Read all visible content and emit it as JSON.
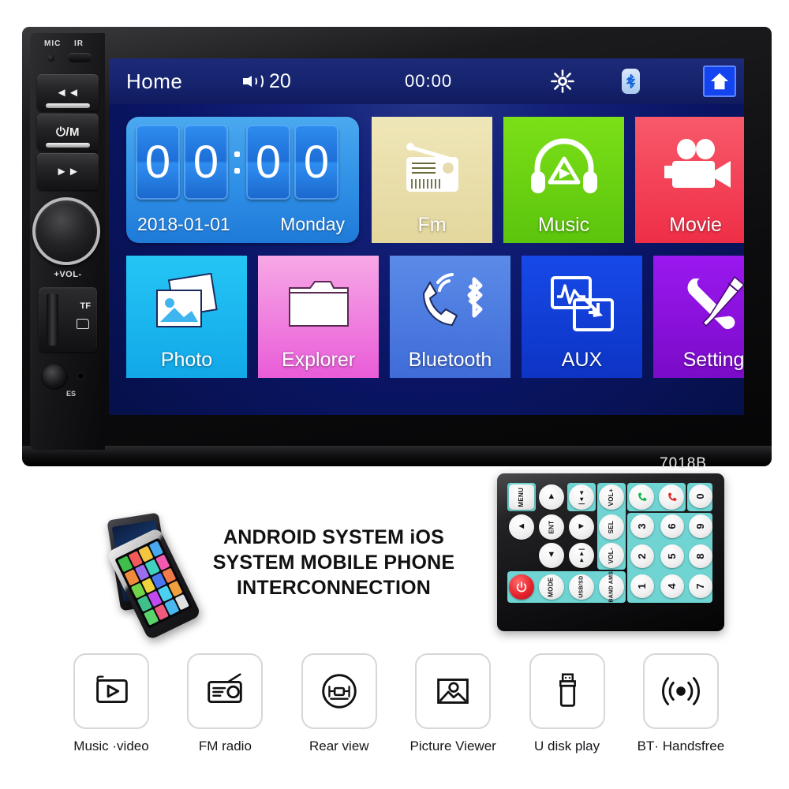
{
  "product": {
    "model": "7018B"
  },
  "head_unit": {
    "left_panel": {
      "mic_label": "MIC",
      "ir_label": "IR",
      "prev_label": "◄◄",
      "power_label": "⏻/M",
      "next_label": "►►",
      "volume_label": "+VOL-",
      "tf_label": "TF",
      "reset_label": "ES"
    },
    "status_bar": {
      "home_label": "Home",
      "volume_icon": "speaker-icon",
      "volume_value": "20",
      "clock": "00:00",
      "brightness_icon": "brightness-icon",
      "bluetooth_icon": "bluetooth-icon",
      "home_button_icon": "home-icon"
    },
    "clock_widget": {
      "digits": [
        "0",
        "0",
        "0",
        "0"
      ],
      "date": "2018-01-01",
      "day": "Monday",
      "background": "#2f8fe6"
    },
    "tiles": [
      {
        "label": "Fm",
        "icon": "radio-icon",
        "color": "#efe6b8",
        "color2": "#e3d79d",
        "text_color": "#ffffff"
      },
      {
        "label": "Music",
        "icon": "headphones-icon",
        "color": "#7ce018",
        "color2": "#5bc40c",
        "text_color": "#ffffff"
      },
      {
        "label": "Movie",
        "icon": "camcorder-icon",
        "color": "#f8596b",
        "color2": "#ef2e46",
        "text_color": "#ffffff"
      },
      {
        "label": "Photo",
        "icon": "photos-icon",
        "color": "#24c6f5",
        "color2": "#12a7e8",
        "text_color": "#ffffff"
      },
      {
        "label": "Explorer",
        "icon": "folder-icon",
        "color": "#f7a8e6",
        "color2": "#e95cd8",
        "text_color": "#ffffff"
      },
      {
        "label": "Bluetooth",
        "icon": "bt-phone-icon",
        "color": "#5b8be8",
        "color2": "#3f6cd8",
        "text_color": "#ffffff"
      },
      {
        "label": "AUX",
        "icon": "aux-wave-icon",
        "color": "#1749e8",
        "color2": "#0d34c4",
        "text_color": "#ffffff"
      },
      {
        "label": "Setting",
        "icon": "tools-icon",
        "color": "#9b18f0",
        "color2": "#7a0bc8",
        "text_color": "#ffffff"
      }
    ]
  },
  "marketing": {
    "line1": "ANDROID SYSTEM iOS",
    "line2": "SYSTEM MOBILE PHONE",
    "line3": "INTERCONNECTION"
  },
  "remote": {
    "keys": [
      {
        "label": "MENU",
        "type": "rounded"
      },
      {
        "label": "▲",
        "type": "round"
      },
      {
        "label": "|◄◄",
        "type": "round"
      },
      {
        "label": "VOL+",
        "type": "round"
      },
      {
        "label": "call-answer-icon",
        "type": "round"
      },
      {
        "label": "call-end-icon",
        "type": "round"
      },
      {
        "label": "0",
        "type": "num"
      },
      {
        "label": "◄",
        "type": "round"
      },
      {
        "label": "ENT",
        "type": "round"
      },
      {
        "label": "►",
        "type": "round"
      },
      {
        "label": "SEL",
        "type": "round"
      },
      {
        "label": "3",
        "type": "num"
      },
      {
        "label": "6",
        "type": "num"
      },
      {
        "label": "9",
        "type": "num"
      },
      {
        "label": "▼",
        "type": "round"
      },
      {
        "label": "►►|",
        "type": "round"
      },
      {
        "label": "VOL-",
        "type": "round"
      },
      {
        "label": "2",
        "type": "num"
      },
      {
        "label": "5",
        "type": "num"
      },
      {
        "label": "8",
        "type": "num"
      },
      {
        "label": "power-icon",
        "type": "round"
      },
      {
        "label": "MODE",
        "type": "round"
      },
      {
        "label": "USB/SD",
        "type": "round"
      },
      {
        "label": "BAND AMS",
        "type": "round"
      },
      {
        "label": "1",
        "type": "num"
      },
      {
        "label": "4",
        "type": "num"
      },
      {
        "label": "7",
        "type": "num"
      }
    ]
  },
  "features": [
    {
      "label": "Music ·video",
      "icon": "video-play-icon"
    },
    {
      "label": "FM radio",
      "icon": "radio-icon"
    },
    {
      "label": "Rear view",
      "icon": "rear-camera-icon"
    },
    {
      "label": "Picture Viewer",
      "icon": "image-icon"
    },
    {
      "label": "U disk  play",
      "icon": "usb-icon"
    },
    {
      "label": "BT· Handsfree",
      "icon": "wireless-icon"
    }
  ]
}
